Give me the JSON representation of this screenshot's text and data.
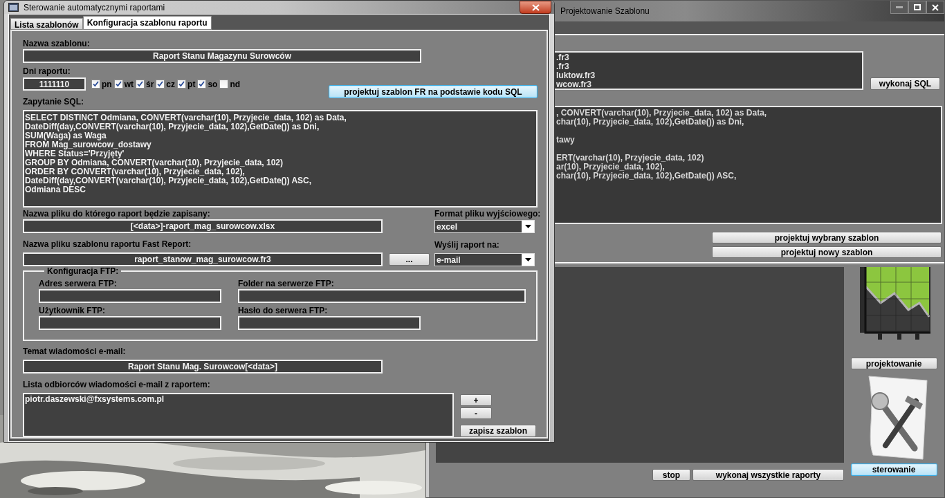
{
  "back_window": {
    "title": "Projektowanie Szablonu",
    "templates": [
      ".fr3",
      ".fr3",
      "luktow.fr3",
      "wcow.fr3"
    ],
    "run_sql_button": "wykonaj SQL",
    "sql_blocks": [
      [
        ", CONVERT(varchar(10), Przyjecie_data, 102) as Data,",
        "char(10), Przyjecie_data, 102),GetDate()) as Dni,"
      ],
      [
        "tawy"
      ],
      [
        "ERT(varchar(10), Przyjecie_data, 102)",
        "ar(10), Przyjecie_data, 102),",
        "char(10), Przyjecie_data, 102),GetDate()) ASC,"
      ]
    ],
    "design_selected_button": "projektuj wybrany szablon",
    "design_new_button": "projektuj nowy szablon",
    "design_mode_button": {
      "label": "projektowanie",
      "focused": false
    },
    "control_mode_button": {
      "label": "sterowanie",
      "focused": true
    },
    "stop_button": "stop",
    "run_all_button": "wykonaj wszystkie raporty"
  },
  "front_window": {
    "title": "Sterowanie automatycznymi raportami",
    "tabs": [
      {
        "label": "Lista szablonów",
        "selected": false
      },
      {
        "label": "Konfiguracja szablonu raportu",
        "selected": true
      }
    ],
    "template_name": {
      "label": "Nazwa szablonu:",
      "value": "Raport Stanu Magazynu Surowców"
    },
    "report_days": {
      "label": "Dni raportu:",
      "value": "1111110",
      "days": [
        {
          "label": "pn",
          "checked": true
        },
        {
          "label": "wt",
          "checked": true
        },
        {
          "label": "śr",
          "checked": true
        },
        {
          "label": "cz",
          "checked": true
        },
        {
          "label": "pt",
          "checked": true
        },
        {
          "label": "so",
          "checked": true
        },
        {
          "label": "nd",
          "checked": false
        }
      ]
    },
    "design_button": {
      "label": "projektuj szablon FR na podstawie kodu SQL",
      "focused": true
    },
    "sql": {
      "label": "Zapytanie SQL:",
      "lines": [
        "SELECT DISTINCT Odmiana, CONVERT(varchar(10), Przyjecie_data, 102) as Data,",
        "DateDiff(day,CONVERT(varchar(10), Przyjecie_data, 102),GetDate()) as Dni,",
        "SUM(Waga) as Waga",
        "FROM Mag_surowcow_dostawy",
        "WHERE Status='Przyjęty'",
        "GROUP BY Odmiana, CONVERT(varchar(10), Przyjecie_data, 102)",
        "ORDER BY CONVERT(varchar(10), Przyjecie_data, 102),",
        "DateDiff(day,CONVERT(varchar(10), Przyjecie_data, 102),GetDate()) ASC,",
        "Odmiana DESC"
      ]
    },
    "output_file": {
      "label": "Nazwa pliku do którego raport będzie zapisany:",
      "value": "[<data>]-raport_mag_surowcow.xlsx"
    },
    "output_format": {
      "label": "Format pliku wyjściowego:",
      "value": "excel"
    },
    "template_file": {
      "label": "Nazwa pliku szablonu raportu Fast Report:",
      "value": "raport_stanow_mag_surowcow.fr3"
    },
    "browse_button": "...",
    "send_to": {
      "label": "Wyślij raport na:",
      "value": "e-mail"
    },
    "ftp": {
      "legend": "Konfiguracja FTP:",
      "fields": [
        {
          "label": "Adres serwera FTP:"
        },
        {
          "label": "Folder na serwerze FTP:"
        },
        {
          "label": "Użytkownik FTP:"
        },
        {
          "label": "Hasło do serwera FTP:"
        }
      ]
    },
    "email_subject": {
      "label": "Temat wiadomości e-mail:",
      "value": "Raport Stanu Mag. Surowcow[<data>]"
    },
    "recipients": {
      "label": "Lista odbiorców wiadomości e-mail z raportem:",
      "items": [
        "piotr.daszewski@fxsystems.com.pl"
      ]
    },
    "add_button": "+",
    "remove_button": "-",
    "save_button": "zapisz szablon"
  }
}
